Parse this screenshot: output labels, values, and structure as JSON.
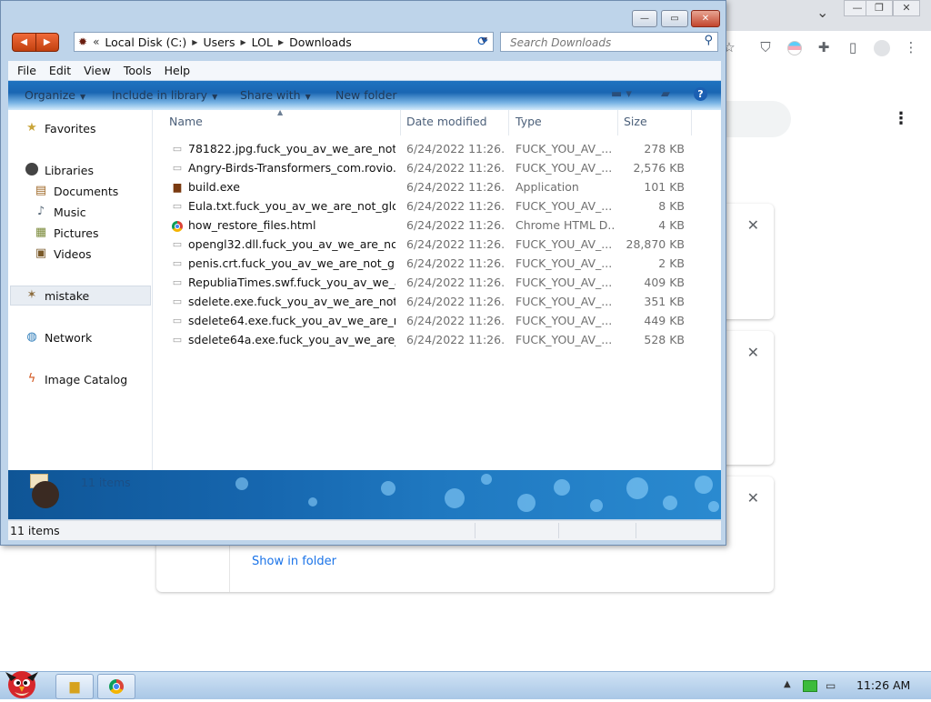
{
  "chrome": {
    "minimize_glyph": "—",
    "restore_glyph": "❐",
    "close_glyph": "✕",
    "chevron_glyph": "⌄",
    "more_glyph": "⋮",
    "show_in_folder": "Show in folder",
    "card_close_glyph": "✕"
  },
  "explorer": {
    "window_buttons": {
      "minimize": "—",
      "maximize": "▭",
      "close": "✕"
    },
    "breadcrumbs": [
      "Local Disk (C:)",
      "Users",
      "LOL",
      "Downloads"
    ],
    "breadcrumb_lead": "«",
    "search_placeholder": "Search Downloads",
    "menu": [
      "File",
      "Edit",
      "View",
      "Tools",
      "Help"
    ],
    "commands": [
      "Organize",
      "Include in library",
      "Share with",
      "New folder"
    ],
    "help_glyph": "?",
    "nav": {
      "favorites": "Favorites",
      "libraries": "Libraries",
      "documents": "Documents",
      "music": "Music",
      "pictures": "Pictures",
      "videos": "Videos",
      "user": "mistake",
      "network": "Network",
      "image_catalog": "Image Catalog"
    },
    "columns": {
      "name": "Name",
      "date": "Date modified",
      "type": "Type",
      "size": "Size"
    },
    "files": [
      {
        "name": "781822.jpg.fuck_you_av_we_are_not_g...",
        "date": "6/24/2022 11:26...",
        "type": "FUCK_YOU_AV_...",
        "size": "278 KB",
        "icon": "doc-icon"
      },
      {
        "name": "Angry-Birds-Transformers_com.rovio...",
        "date": "6/24/2022 11:26...",
        "type": "FUCK_YOU_AV_...",
        "size": "2,576 KB",
        "icon": "doc-icon"
      },
      {
        "name": "build.exe",
        "date": "6/24/2022 11:26...",
        "type": "Application",
        "size": "101 KB",
        "icon": "exe-icon"
      },
      {
        "name": "Eula.txt.fuck_you_av_we_are_not_glob...",
        "date": "6/24/2022 11:26...",
        "type": "FUCK_YOU_AV_...",
        "size": "8 KB",
        "icon": "doc-icon"
      },
      {
        "name": "how_restore_files.html",
        "date": "6/24/2022 11:26...",
        "type": "Chrome HTML D...",
        "size": "4 KB",
        "icon": "chrome-icon"
      },
      {
        "name": "opengl32.dll.fuck_you_av_we_are_not_...",
        "date": "6/24/2022 11:26...",
        "type": "FUCK_YOU_AV_...",
        "size": "28,870 KB",
        "icon": "doc-icon"
      },
      {
        "name": "penis.crt.fuck_you_av_we_are_not_glo...",
        "date": "6/24/2022 11:26...",
        "type": "FUCK_YOU_AV_...",
        "size": "2 KB",
        "icon": "doc-icon"
      },
      {
        "name": "RepubliaTimes.swf.fuck_you_av_we_ar...",
        "date": "6/24/2022 11:26...",
        "type": "FUCK_YOU_AV_...",
        "size": "409 KB",
        "icon": "doc-icon"
      },
      {
        "name": "sdelete.exe.fuck_you_av_we_are_not_...",
        "date": "6/24/2022 11:26...",
        "type": "FUCK_YOU_AV_...",
        "size": "351 KB",
        "icon": "doc-icon"
      },
      {
        "name": "sdelete64.exe.fuck_you_av_we_are_no...",
        "date": "6/24/2022 11:26...",
        "type": "FUCK_YOU_AV_...",
        "size": "449 KB",
        "icon": "doc-icon"
      },
      {
        "name": "sdelete64a.exe.fuck_you_av_we_are_n...",
        "date": "6/24/2022 11:26...",
        "type": "FUCK_YOU_AV_...",
        "size": "528 KB",
        "icon": "doc-icon"
      }
    ],
    "details_count": "11 items",
    "status_count": "11 items"
  },
  "taskbar": {
    "clock": "11:26 AM",
    "tray_arrow": "▲"
  },
  "colors": {
    "accent": "#1a66b3",
    "link": "#1a73e8",
    "close": "#c2452d"
  }
}
